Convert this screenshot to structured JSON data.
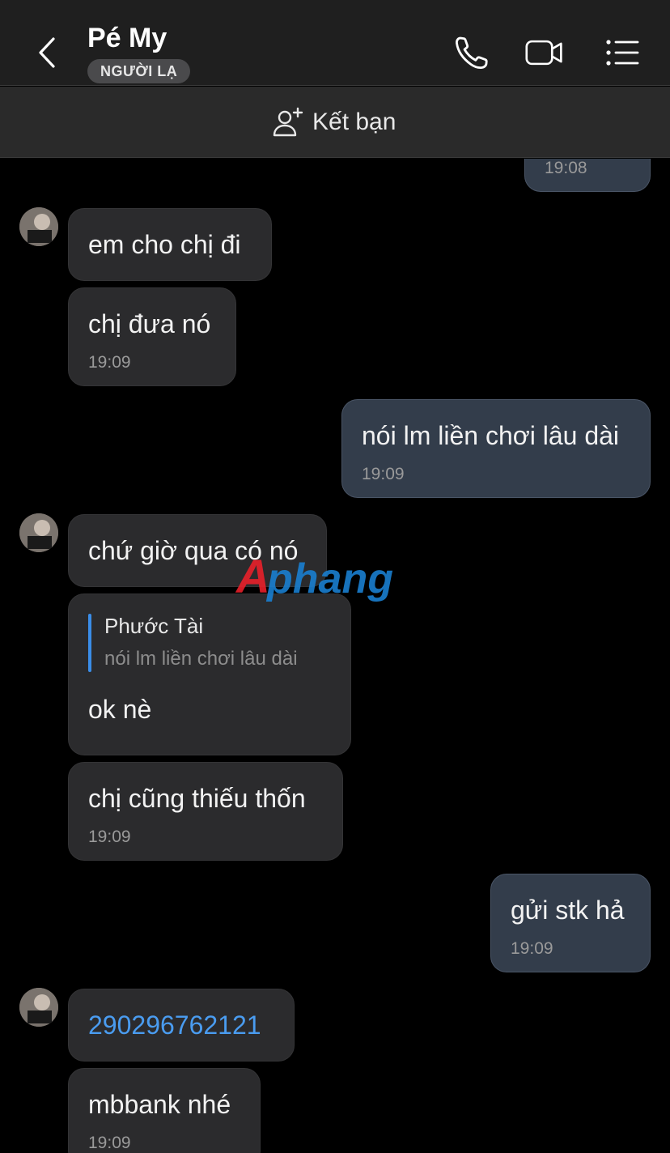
{
  "header": {
    "contact_name": "Pé My",
    "badge": "NGƯỜI LẠ",
    "back_icon": "chevron-left-icon",
    "call_icon": "phone-icon",
    "video_icon": "video-camera-icon",
    "menu_icon": "list-menu-icon"
  },
  "friend_bar": {
    "label": "Kết bạn",
    "icon": "add-user-icon"
  },
  "messages": [
    {
      "side": "out",
      "text": "",
      "time": "19:08"
    },
    {
      "side": "in",
      "text": "em cho chị đi",
      "time": ""
    },
    {
      "side": "in",
      "text": "chị đưa nó",
      "time": "19:09"
    },
    {
      "side": "out",
      "text": "nói lm liền chơi lâu dài",
      "time": "19:09"
    },
    {
      "side": "in",
      "text": "chứ giờ qua có nó",
      "time": ""
    },
    {
      "side": "in",
      "text": "ok nè",
      "time": "",
      "quote": {
        "name": "Phước Tài",
        "text": "nói lm liền chơi lâu dài"
      }
    },
    {
      "side": "in",
      "text": "chị cũng thiếu thốn",
      "time": "19:09"
    },
    {
      "side": "out",
      "text": "gửi stk hả",
      "time": "19:09"
    },
    {
      "side": "in",
      "text": "290296762121",
      "time": "",
      "is_link": true
    },
    {
      "side": "in",
      "text": "mbbank nhé",
      "time": "19:09"
    }
  ],
  "watermark": "Aphang",
  "colors": {
    "background": "#000000",
    "incoming_bubble": "#2b2b2d",
    "outgoing_bubble": "#333d4b",
    "link": "#4a9cf0",
    "quote_bar": "#3a8de8",
    "watermark_red": "#e8202a",
    "watermark_blue": "#1a7fd0"
  }
}
